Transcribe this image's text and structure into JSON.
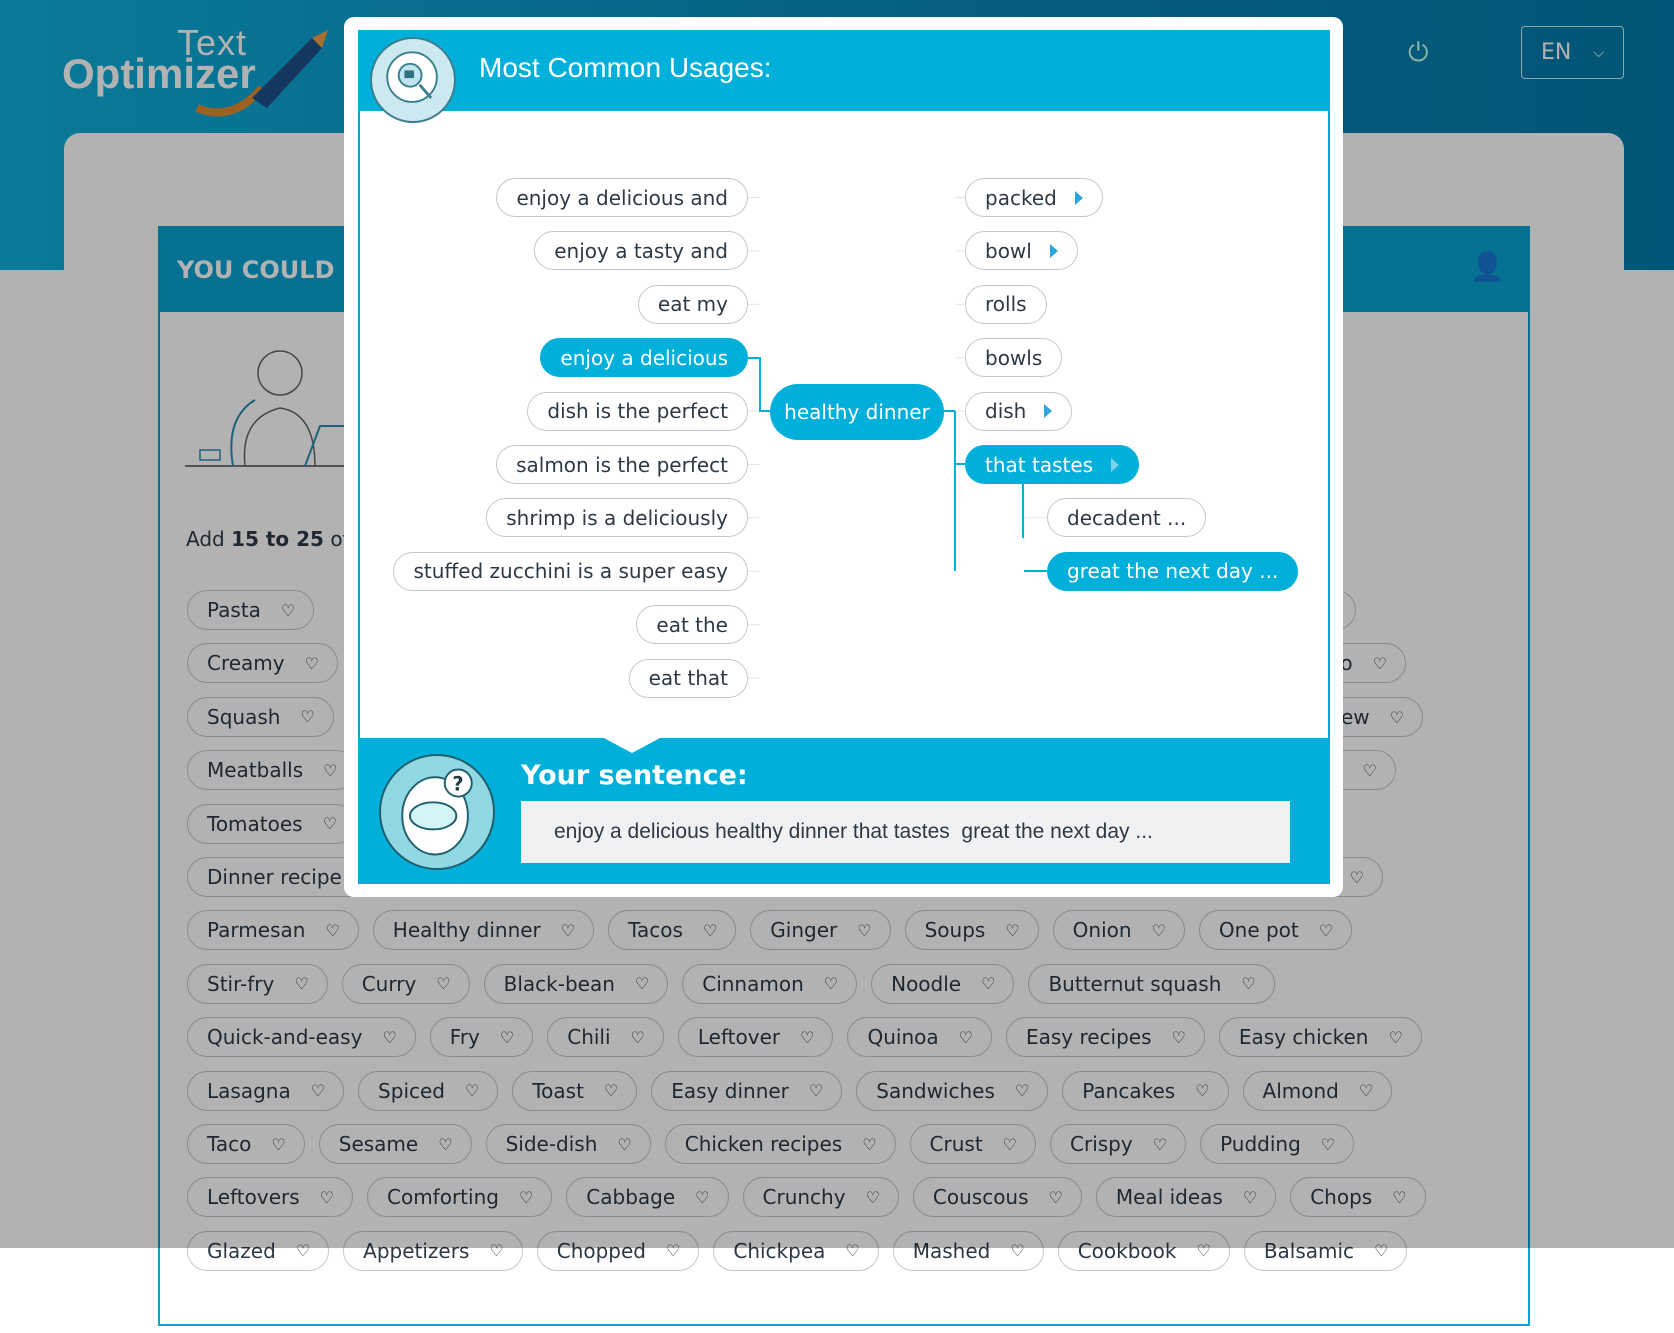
{
  "header": {
    "logo_line1": "Text",
    "logo_line2": "Optimizer",
    "language": "EN",
    "icons": [
      "power-icon",
      "chevron-down-icon"
    ]
  },
  "panel": {
    "title": "YOU COULD I",
    "instruction_pre": "Add ",
    "instruction_bold": "15 to 25",
    "instruction_post": " of t"
  },
  "tag_rows": [
    [
      "Pasta"
    ],
    [
      "Creamy"
    ],
    [
      "Squash"
    ],
    [
      "Meatballs"
    ],
    [
      "Tomatoes"
    ],
    [
      "Dinner recipe"
    ],
    [
      "Parmesan",
      "Healthy dinner",
      "Tacos",
      "Ginger",
      "Soups",
      "Onion",
      "One pot"
    ],
    [
      "Stir-fry",
      "Curry",
      "Black-bean",
      "Cinnamon",
      "Noodle",
      "Butternut squash"
    ],
    [
      "Quick-and-easy",
      "Fry",
      "Chili",
      "Leftover",
      "Quinoa",
      "Easy recipes",
      "Easy chicken"
    ],
    [
      "Lasagna",
      "Spiced",
      "Toast",
      "Easy dinner",
      "Sandwiches",
      "Pancakes",
      "Almond"
    ],
    [
      "Taco",
      "Sesame",
      "Side-dish",
      "Chicken recipes",
      "Crust",
      "Crispy",
      "Pudding"
    ],
    [
      "Leftovers",
      "Comforting",
      "Cabbage",
      "Crunchy",
      "Couscous",
      "Meal ideas",
      "Chops"
    ],
    [
      "Glazed",
      "Appetizers",
      "Chopped",
      "Chickpea",
      "Mashed",
      "Cookbook",
      "Balsamic"
    ]
  ],
  "partial_tags": [
    "o",
    "ew"
  ],
  "modal": {
    "title": "Most Common Usages:",
    "left_nodes": [
      {
        "label": "enjoy a delicious and",
        "active": false
      },
      {
        "label": "enjoy a tasty and",
        "active": false
      },
      {
        "label": "eat my",
        "active": false
      },
      {
        "label": "enjoy a delicious",
        "active": true
      },
      {
        "label": "dish is the perfect",
        "active": false
      },
      {
        "label": "salmon is the perfect",
        "active": false
      },
      {
        "label": "shrimp is a deliciously",
        "active": false
      },
      {
        "label": "stuffed zucchini is a super easy",
        "active": false
      },
      {
        "label": "eat the",
        "active": false
      },
      {
        "label": "eat that",
        "active": false
      }
    ],
    "center_node": "healthy dinner",
    "right_nodes": [
      {
        "label": "packed",
        "arrow": true,
        "active": false,
        "indent": false
      },
      {
        "label": "bowl",
        "arrow": true,
        "active": false,
        "indent": false
      },
      {
        "label": "rolls",
        "arrow": false,
        "active": false,
        "indent": false
      },
      {
        "label": "bowls",
        "arrow": false,
        "active": false,
        "indent": false
      },
      {
        "label": "dish",
        "arrow": true,
        "active": false,
        "indent": false
      },
      {
        "label": "that tastes",
        "arrow": true,
        "active": true,
        "indent": false
      },
      {
        "label": "decadent ...",
        "arrow": false,
        "active": false,
        "indent": true
      },
      {
        "label": "great the next day ...",
        "arrow": false,
        "active": true,
        "indent": true
      }
    ],
    "sentence_label": "Your sentence:",
    "sentence": "enjoy a delicious healthy dinner that tastes  great the next day ..."
  },
  "colors": {
    "accent": "#00b0da",
    "header": "#0a86b6",
    "text": "#2d3a45"
  }
}
